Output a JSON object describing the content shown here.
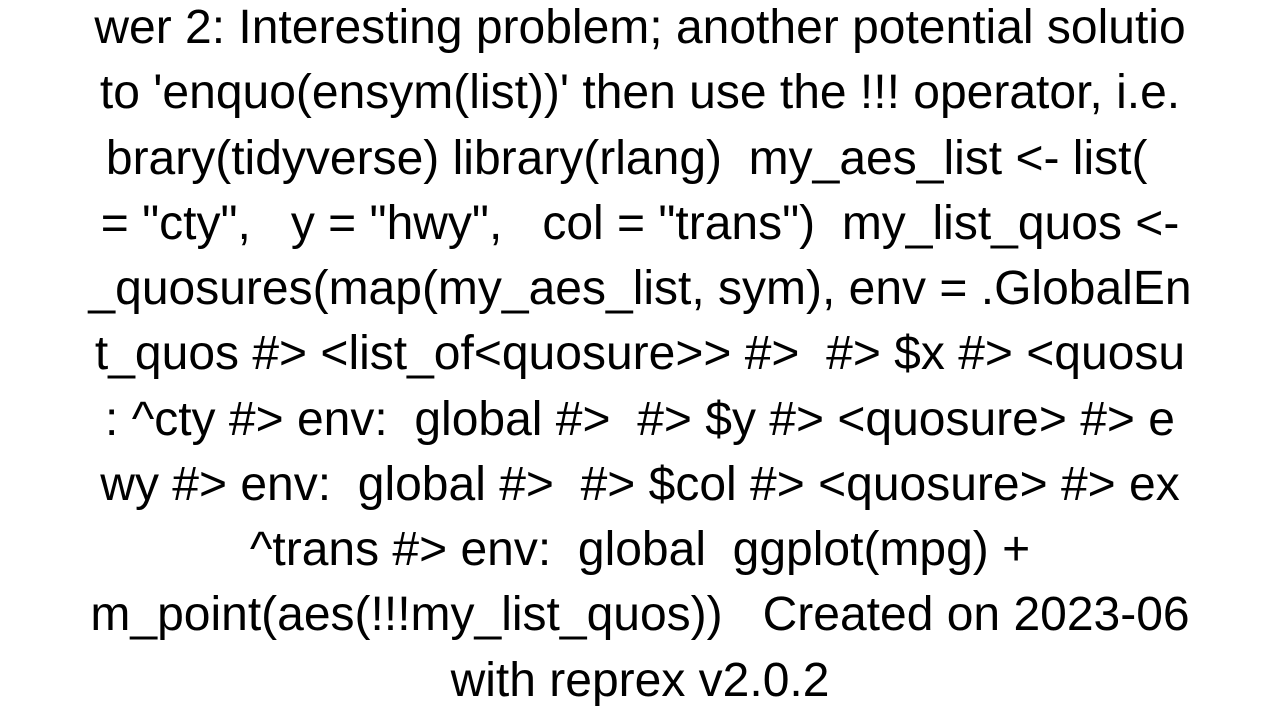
{
  "lines": [
    "wer 2: Interesting problem; another potential solutio",
    "to 'enquo(ensym(list))' then use the !!! operator, i.e.",
    "brary(tidyverse) library(rlang)  my_aes_list <- list(  ",
    "= \"cty\",   y = \"hwy\",   col = \"trans\")  my_list_quos <-",
    "_quosures(map(my_aes_list, sym), env = .GlobalEn",
    "t_quos #> <list_of<quosure>> #>  #> $x #> <quosu",
    ": ^cty #> env:  global #>  #> $y #> <quosure> #> e",
    "wy #> env:  global #>  #> $col #> <quosure> #> ex",
    "^trans #> env:  global  ggplot(mpg) +",
    "m_point(aes(!!!my_list_quos))   Created on 2023-06",
    "with reprex v2.0.2"
  ]
}
